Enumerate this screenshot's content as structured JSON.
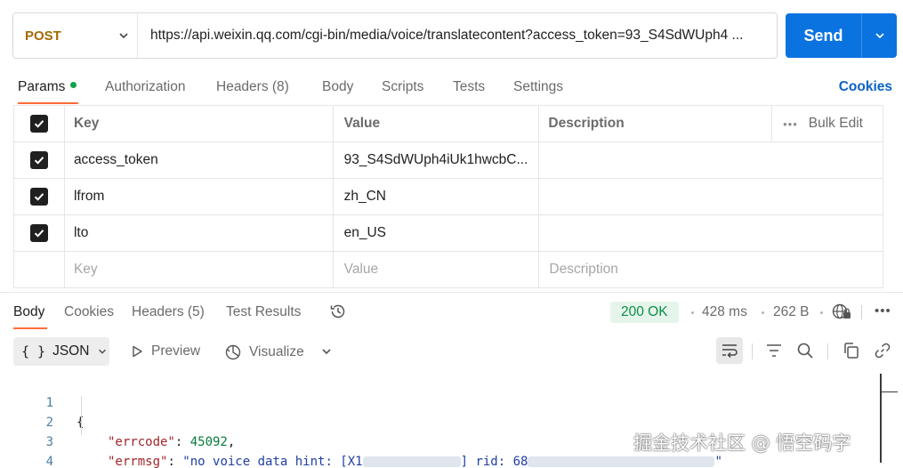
{
  "request": {
    "method": "POST",
    "url": "https://api.weixin.qq.com/cgi-bin/media/voice/translatecontent?access_token=93_S4SdWUph4 ...",
    "send_label": "Send"
  },
  "request_tabs": [
    {
      "label": "Params"
    },
    {
      "label": "Authorization"
    },
    {
      "label": "Headers (8)"
    },
    {
      "label": "Body"
    },
    {
      "label": "Scripts"
    },
    {
      "label": "Tests"
    },
    {
      "label": "Settings"
    }
  ],
  "cookies_label": "Cookies",
  "params_table": {
    "headers": {
      "key": "Key",
      "value": "Value",
      "description": "Description",
      "bulk_edit": "Bulk Edit"
    },
    "rows": [
      {
        "key": "access_token",
        "value": "93_S4SdWUph4iUk1hwcbC...",
        "description": ""
      },
      {
        "key": "lfrom",
        "value": "zh_CN",
        "description": ""
      },
      {
        "key": "lto",
        "value": "en_US",
        "description": ""
      }
    ],
    "placeholders": {
      "key": "Key",
      "value": "Value",
      "description": "Description"
    }
  },
  "response_tabs": [
    {
      "label": "Body"
    },
    {
      "label": "Cookies"
    },
    {
      "label": "Headers (5)"
    },
    {
      "label": "Test Results"
    }
  ],
  "response_meta": {
    "status": "200 OK",
    "time": "428 ms",
    "size": "262 B"
  },
  "toolbar": {
    "format": "JSON",
    "preview": "Preview",
    "visualize": "Visualize"
  },
  "code": {
    "line_numbers": [
      "1",
      "2",
      "3",
      "4"
    ],
    "open_brace": "{",
    "close_brace": "}",
    "errcode_key": "\"errcode\"",
    "errcode_value": "45092",
    "errmsg_key": "\"errmsg\"",
    "errmsg_part1": "\"no voice data hint: [X1",
    "errmsg_part2": "] rid: 68",
    "errmsg_part3": "\""
  },
  "watermark": "掘金技术社区 @ 悟空码字",
  "colors": {
    "accent": "#ff6c37",
    "send": "#0b73e0",
    "status_ok": "#0a8f45",
    "method": "#a46b00"
  }
}
